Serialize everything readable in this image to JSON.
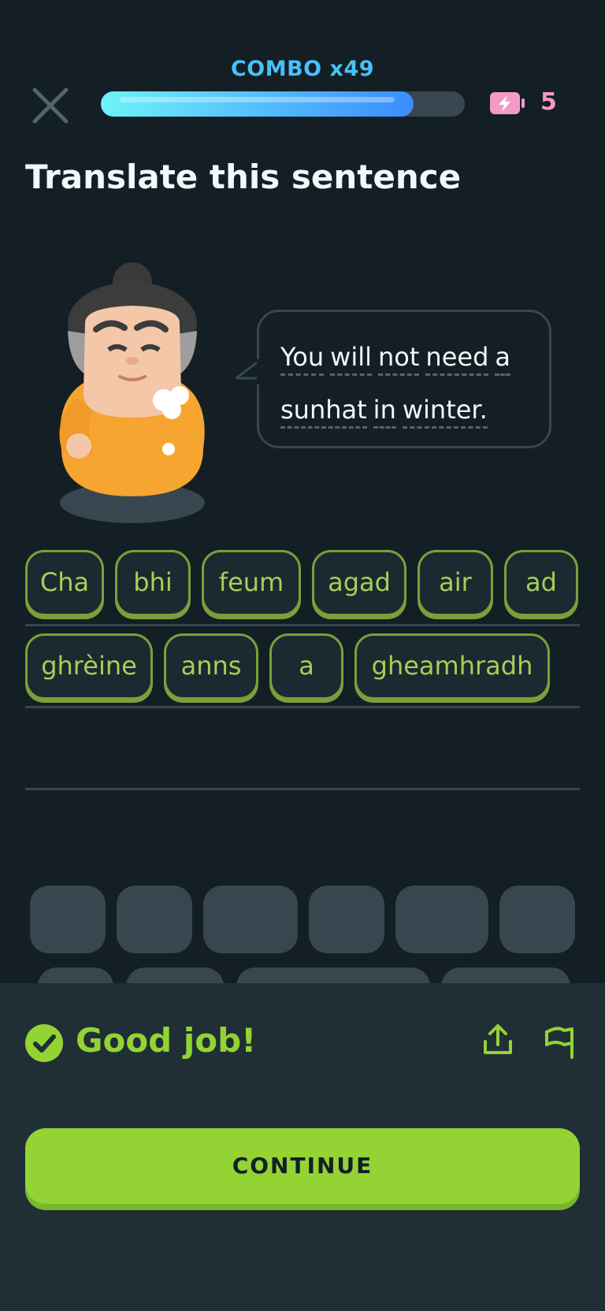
{
  "header": {
    "combo": "COMBO x49",
    "progress": 0.86,
    "energy_count": "5"
  },
  "prompt": {
    "title": "Translate this sentence",
    "sentence_words_line1": [
      "You",
      "will",
      "not",
      "need",
      "a"
    ],
    "sentence_words_line2": [
      "sunhat",
      "in",
      "winter."
    ]
  },
  "answer": {
    "row1": [
      "Cha",
      "bhi",
      "feum",
      "agad",
      "air",
      "ad"
    ],
    "row2": [
      "ghrèine",
      "anns",
      "a",
      "gheamhradh"
    ]
  },
  "feedback": {
    "message": "Good job!",
    "continue_label": "CONTINUE"
  },
  "colors": {
    "background": "#131f24",
    "accent_green": "#93d333",
    "combo_blue": "#49c0f8",
    "energy_pink": "#f49ac8"
  },
  "icons": {
    "close": "close-icon",
    "energy": "energy-battery-icon",
    "check": "check-icon",
    "share": "share-icon",
    "flag": "report-flag-icon"
  }
}
